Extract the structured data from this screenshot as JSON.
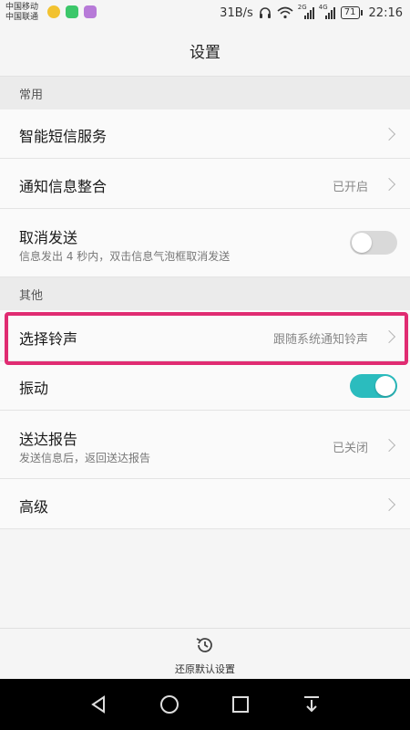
{
  "status_bar": {
    "carrier1": "中国移动",
    "carrier2": "中国联通",
    "speed": "31B/s",
    "net1": "2G",
    "net2": "4G",
    "battery": "71",
    "time": "22:16"
  },
  "title": "设置",
  "sections": {
    "common": "常用",
    "other": "其他"
  },
  "items": {
    "smart_sms": {
      "title": "智能短信服务"
    },
    "notify_merge": {
      "title": "通知信息整合",
      "value": "已开启"
    },
    "cancel_send": {
      "title": "取消发送",
      "subtitle": "信息发出 4 秒内，双击信息气泡框取消发送",
      "toggle": "off"
    },
    "ringtone": {
      "title": "选择铃声",
      "value": "跟随系统通知铃声"
    },
    "vibrate": {
      "title": "振动",
      "toggle": "on"
    },
    "delivery_report": {
      "title": "送达报告",
      "subtitle": "发送信息后，返回送达报告",
      "value": "已关闭"
    },
    "advanced": {
      "title": "高级"
    }
  },
  "bottom": {
    "restore_label": "还原默认设置"
  },
  "colors": {
    "accent": "#2bbcbe",
    "highlight": "#e02c72"
  }
}
